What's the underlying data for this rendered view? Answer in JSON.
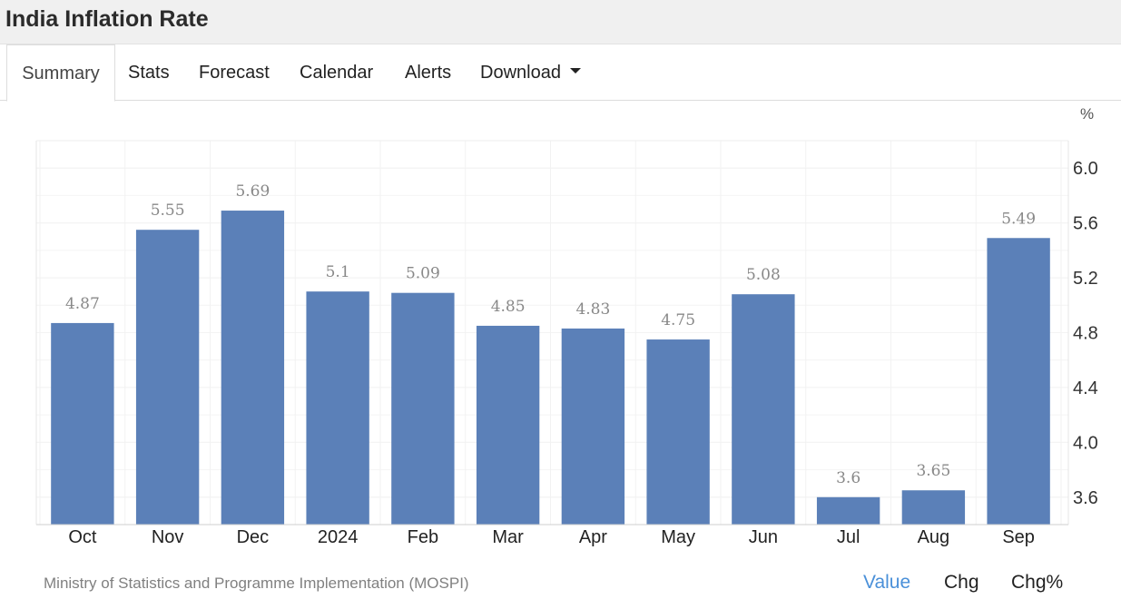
{
  "header": {
    "title": "India Inflation Rate"
  },
  "tabs": [
    {
      "label": "Summary",
      "active": true
    },
    {
      "label": "Stats"
    },
    {
      "label": "Forecast"
    },
    {
      "label": "Calendar"
    },
    {
      "label": "Alerts"
    },
    {
      "label": "Download",
      "dropdown": true
    }
  ],
  "footer": {
    "source": "Ministry of Statistics and Programme Implementation (MOSPI)",
    "toggles": [
      {
        "label": "Value",
        "active": true
      },
      {
        "label": "Chg"
      },
      {
        "label": "Chg%"
      }
    ]
  },
  "colors": {
    "bar": "#5b80b8",
    "active_toggle": "#4a90d9",
    "grid": "#ececec",
    "data_label": "#888888"
  },
  "chart_data": {
    "type": "bar",
    "unit": "%",
    "categories": [
      "Oct",
      "Nov",
      "Dec",
      "2024",
      "Feb",
      "Mar",
      "Apr",
      "May",
      "Jun",
      "Jul",
      "Aug",
      "Sep"
    ],
    "values": [
      4.87,
      5.55,
      5.69,
      5.1,
      5.09,
      4.85,
      4.83,
      4.75,
      5.08,
      3.6,
      3.65,
      5.49
    ],
    "data_labels": [
      "4.87",
      "5.55",
      "5.69",
      "5.1",
      "5.09",
      "4.85",
      "4.83",
      "4.75",
      "5.08",
      "3.6",
      "3.65",
      "5.49"
    ],
    "y_ticks": [
      "3.6",
      "4.0",
      "4.4",
      "4.8",
      "5.2",
      "5.6",
      "6.0"
    ],
    "ylim": [
      3.4,
      6.2
    ],
    "y_axis_side": "right",
    "grid": true
  }
}
